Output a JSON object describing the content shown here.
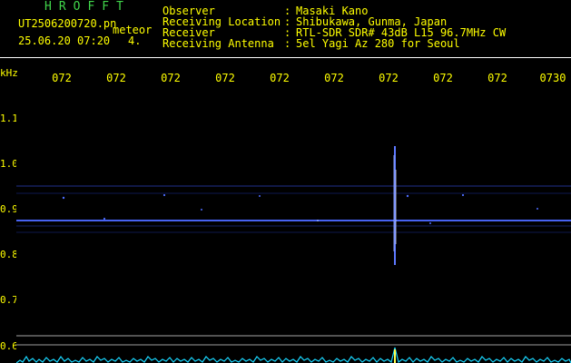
{
  "colors": {
    "background": "#000000",
    "yellow": "#ffff00",
    "green": "#41d64b",
    "white": "#ffffff",
    "blue_band": "#3b58ff",
    "blue_light": "#8aa5ff",
    "cyan_noise": "#19d7ff",
    "signal_yellow": "#ffff4a"
  },
  "header": {
    "brand": "HROFFT",
    "file_name": "UT2506200720.pn",
    "tag": "meteor",
    "date_time": "25.06.20 07:20",
    "count": "4.",
    "info_rows": [
      {
        "label": "Observer",
        "value": "Masaki Kano"
      },
      {
        "label": "Receiving Location",
        "value": "Shibukawa, Gunma, Japan"
      },
      {
        "label": "Receiver",
        "value": "RTL-SDR SDR# 43dB L15 96.7MHz CW"
      },
      {
        "label": "Receiving Antenna",
        "value": "5el Yagi Az 280 for Seoul"
      }
    ],
    "separator": ":"
  },
  "axes": {
    "frequency_unit": "kHz",
    "frequency_labels": [
      "1.1",
      "1.0",
      "0.9",
      "0.8",
      "0.7",
      "0.6"
    ],
    "time_labels": [
      "072",
      "072",
      "072",
      "072",
      "072",
      "072",
      "072",
      "072",
      "072",
      "0730"
    ]
  }
}
